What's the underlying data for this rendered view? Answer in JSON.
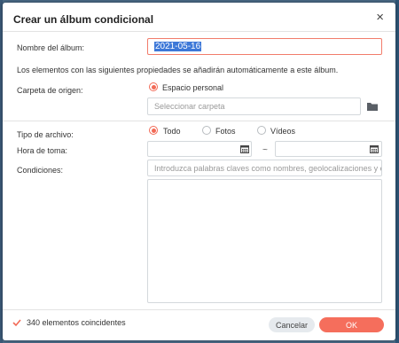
{
  "dialog": {
    "title": "Crear un álbum condicional",
    "close_symbol": "×"
  },
  "album_name": {
    "label": "Nombre del álbum:",
    "value": "2021-05-16"
  },
  "info_text": "Los elementos con las siguientes propiedades se añadirán automáticamente a este álbum.",
  "source_folder": {
    "label": "Carpeta de origen:",
    "option": "Espacio personal",
    "placeholder": "Seleccionar carpeta"
  },
  "file_type": {
    "label": "Tipo de archivo:",
    "options": [
      "Todo",
      "Fotos",
      "Vídeos"
    ],
    "selected": "Todo"
  },
  "capture_time": {
    "label": "Hora de toma:",
    "separator": "~"
  },
  "conditions": {
    "label": "Condiciones:",
    "placeholder": "Introduzca palabras claves como nombres, geolocalizaciones y etiquetas"
  },
  "footer": {
    "match_count": "340 elementos coincidentes",
    "cancel_label": "Cancelar",
    "ok_label": "OK"
  },
  "colors": {
    "accent": "#f56e5c",
    "selection": "#3d78d8"
  },
  "icons": [
    "close-icon",
    "folder-icon",
    "calendar-icon",
    "check-icon"
  ]
}
